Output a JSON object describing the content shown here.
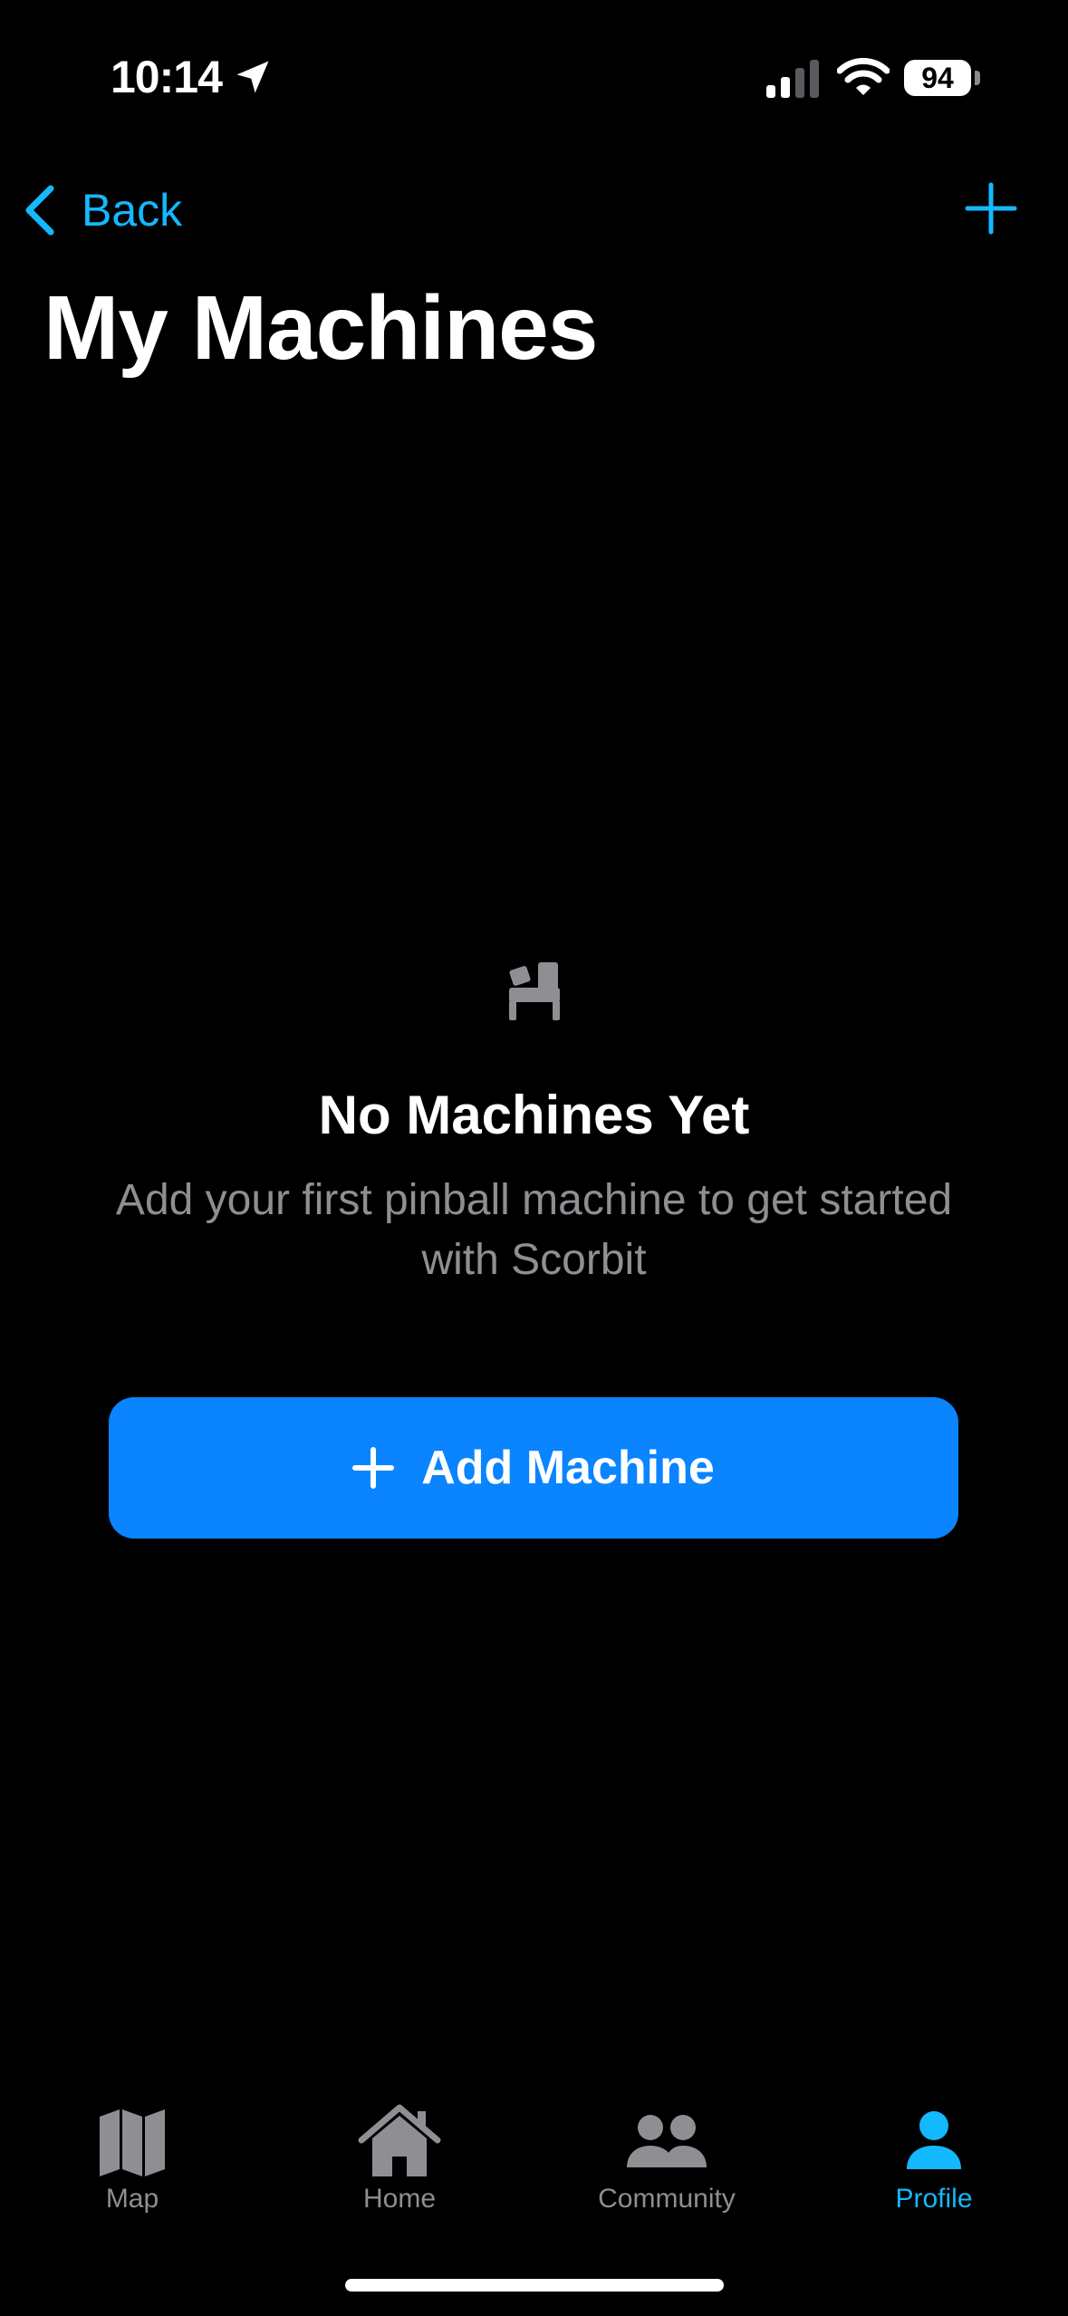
{
  "status_bar": {
    "time": "10:14",
    "battery": "94"
  },
  "nav": {
    "back_label": "Back",
    "title": "My Machines"
  },
  "empty_state": {
    "icon": "pinball-machine-icon",
    "title": "No Machines Yet",
    "description": "Add your first pinball machine to get started with Scorbit",
    "button_label": "Add Machine"
  },
  "tabs": [
    {
      "label": "Map",
      "icon": "map-icon",
      "active": false
    },
    {
      "label": "Home",
      "icon": "house-icon",
      "active": false
    },
    {
      "label": "Community",
      "icon": "people-icon",
      "active": false
    },
    {
      "label": "Profile",
      "icon": "person-icon",
      "active": true
    }
  ],
  "colors": {
    "accent": "#14b8ff",
    "button": "#0a84ff",
    "background": "#000000",
    "secondary_text": "#8e8e93"
  }
}
